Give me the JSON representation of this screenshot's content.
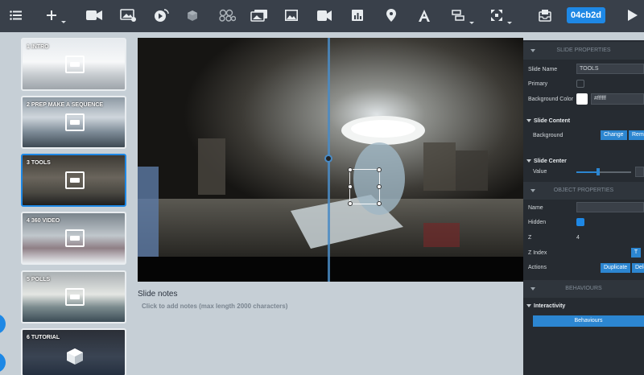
{
  "project": {
    "id": "04cb2d"
  },
  "toolbar": {
    "icons": [
      "menu-icon",
      "add-icon",
      "video-slide-icon",
      "image-slide-icon",
      "stream-icon",
      "3d-model-icon",
      "molecule-icon",
      "gallery-icon",
      "image-icon",
      "video-icon",
      "chart-icon",
      "map-pin-icon",
      "text-icon",
      "hierarchy-icon",
      "fullscreen-icon",
      "inbox-icon",
      "play-icon"
    ]
  },
  "slides": [
    {
      "label": "1 INTRO",
      "selected": false
    },
    {
      "label": "2 PREP MAKE A SEQUENCE",
      "selected": false
    },
    {
      "label": "3 TOOLS",
      "selected": true
    },
    {
      "label": "4 360 VIDEO",
      "selected": false
    },
    {
      "label": "5 POLLS",
      "selected": false
    },
    {
      "label": "6 TUTORIAL",
      "selected": false
    }
  ],
  "notes": {
    "title": "Slide notes",
    "placeholder": "Click to add notes (max length 2000 characters)"
  },
  "slide_properties": {
    "header": "SLIDE PROPERTIES",
    "name_label": "Slide Name",
    "name_value": "TOOLS",
    "primary_label": "Primary",
    "bg_color_label": "Background Color",
    "bg_color_value": "#ffffff",
    "content_header": "Slide Content",
    "background_label": "Background",
    "change_btn": "Change",
    "remove_btn": "Remo",
    "center_header": "Slide Center",
    "value_label": "Value"
  },
  "object_properties": {
    "header": "OBJECT PROPERTIES",
    "name_label": "Name",
    "hidden_label": "Hidden",
    "hidden_checked": true,
    "z_label": "Z",
    "z_value": "4",
    "zindex_label": "Z Index",
    "zindex_btn": "T",
    "actions_label": "Actions",
    "duplicate_btn": "Duplicate",
    "delete_btn": "Dele"
  },
  "behaviours": {
    "header": "BEHAVIOURS",
    "interactivity_label": "Interactivity",
    "behaviours_btn": "Behaviours"
  },
  "colors": {
    "accent": "#1e88e5",
    "toolbar": "#39404a",
    "panel": "#262b31"
  }
}
